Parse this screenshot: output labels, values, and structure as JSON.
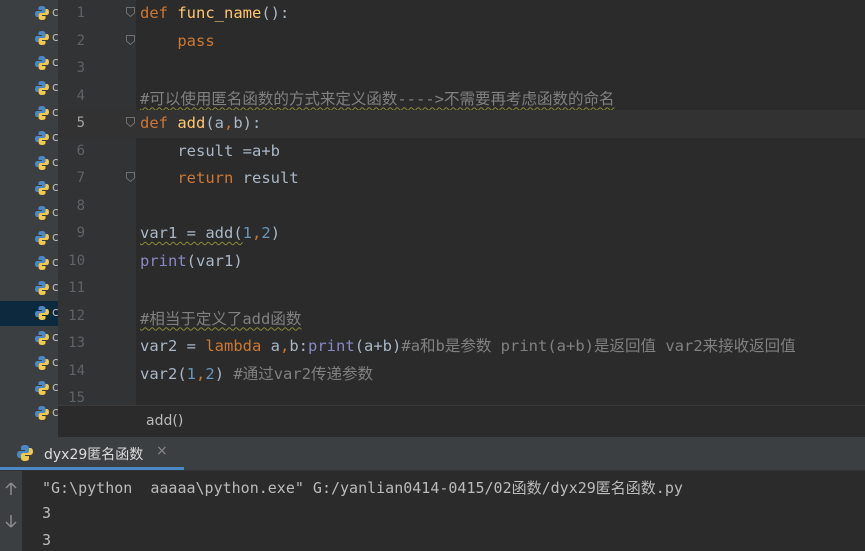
{
  "sidebar": {
    "items": [
      {
        "letter": "c",
        "selected": false
      },
      {
        "letter": "c",
        "selected": false
      },
      {
        "letter": "c",
        "selected": false
      },
      {
        "letter": "c",
        "selected": false
      },
      {
        "letter": "c",
        "selected": false
      },
      {
        "letter": "c",
        "selected": false
      },
      {
        "letter": "c",
        "selected": false
      },
      {
        "letter": "c",
        "selected": false
      },
      {
        "letter": "c",
        "selected": false
      },
      {
        "letter": "c",
        "selected": false
      },
      {
        "letter": "c",
        "selected": false
      },
      {
        "letter": "c",
        "selected": false
      },
      {
        "letter": "c",
        "selected": true
      },
      {
        "letter": "c",
        "selected": false
      },
      {
        "letter": "c",
        "selected": false
      },
      {
        "letter": "c",
        "selected": false
      },
      {
        "letter": "c",
        "selected": false
      }
    ]
  },
  "editor": {
    "current_line": 5,
    "lines": [
      {
        "n": "1",
        "tokens": [
          [
            "kw",
            "def "
          ],
          [
            "fn",
            "func_name"
          ],
          [
            "",
            "():"
          ]
        ]
      },
      {
        "n": "2",
        "tokens": [
          [
            "",
            "    "
          ],
          [
            "kw",
            "pass"
          ]
        ]
      },
      {
        "n": "3",
        "tokens": []
      },
      {
        "n": "4",
        "tokens": [
          [
            "cm wavy",
            "#可以使用匿名函数的方式来定义函数---->不需要再考虑函数的命名"
          ]
        ]
      },
      {
        "n": "5",
        "tokens": [
          [
            "kw",
            "def "
          ],
          [
            "fn",
            "add"
          ],
          [
            "",
            "(a"
          ],
          [
            "kw",
            ","
          ],
          [
            "",
            "b):"
          ]
        ]
      },
      {
        "n": "6",
        "tokens": [
          [
            "",
            "    result "
          ],
          [
            "",
            "="
          ],
          [
            "",
            "a+b"
          ]
        ]
      },
      {
        "n": "7",
        "tokens": [
          [
            "",
            "    "
          ],
          [
            "kw",
            "return "
          ],
          [
            "",
            "result"
          ]
        ]
      },
      {
        "n": "8",
        "tokens": []
      },
      {
        "n": "9",
        "tokens": [
          [
            "wavy",
            "var1 = add("
          ],
          [
            "num",
            "1"
          ],
          [
            "kw",
            ","
          ],
          [
            "num",
            "2"
          ],
          [
            "",
            ")"
          ]
        ]
      },
      {
        "n": "10",
        "tokens": [
          [
            "bi",
            "print"
          ],
          [
            "",
            "(var1)"
          ]
        ]
      },
      {
        "n": "11",
        "tokens": []
      },
      {
        "n": "12",
        "tokens": [
          [
            "cm wavy",
            "#相当于定义了add函数"
          ]
        ]
      },
      {
        "n": "13",
        "tokens": [
          [
            "",
            "var2 = "
          ],
          [
            "kw",
            "lambda "
          ],
          [
            "",
            "a"
          ],
          [
            "kw",
            ","
          ],
          [
            "",
            "b:"
          ],
          [
            "bi",
            "print"
          ],
          [
            "",
            "(a+b)"
          ],
          [
            "cm",
            "#a和b是参数 print(a+b)是返回值 var2来接收返回值"
          ]
        ]
      },
      {
        "n": "14",
        "tokens": [
          [
            "",
            "var2("
          ],
          [
            "num",
            "1"
          ],
          [
            "kw",
            ","
          ],
          [
            "num",
            "2"
          ],
          [
            "",
            ") "
          ],
          [
            "cm",
            "#通过var2传递参数"
          ]
        ]
      },
      {
        "n": "15",
        "tokens": []
      }
    ]
  },
  "breadcrumb": {
    "label": "add()"
  },
  "run": {
    "tab_label": "dyx29匿名函数",
    "close_glyph": "×",
    "output": [
      "\"G:\\python  aaaaa\\python.exe\" G:/yanlian0414-0415/02函数/dyx29匿名函数.py",
      "3",
      "3"
    ]
  },
  "colors": {
    "keyword": "#cc7832",
    "function": "#ffc66d",
    "number": "#6897bb",
    "builtin": "#8888c6",
    "comment": "#808080"
  }
}
